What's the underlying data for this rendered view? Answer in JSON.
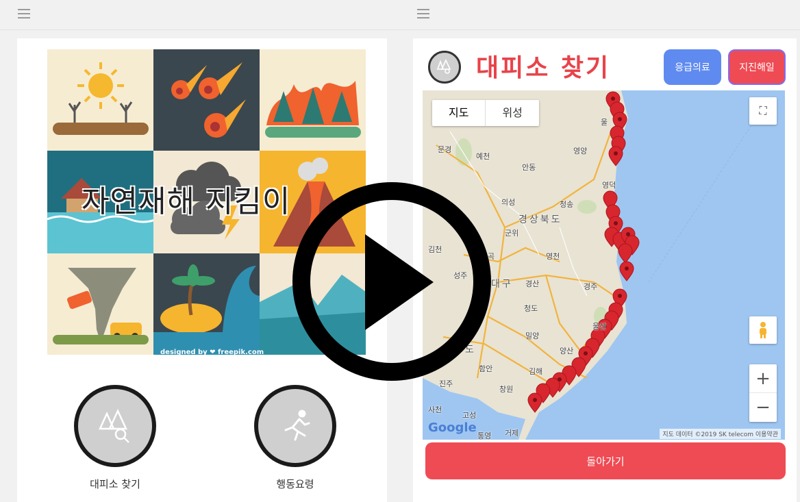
{
  "left_screen": {
    "hero_title": "자연재해 지킴이",
    "hero_credit": "designed by ❤ freepik.com",
    "buttons": [
      {
        "label": "대피소 찾기",
        "icon": "shelter-icon"
      },
      {
        "label": "행동요령",
        "icon": "running-person-icon"
      }
    ]
  },
  "right_screen": {
    "title": "대피소 찾기",
    "emergency_button": "응급의료",
    "earthquake_button": "지진해일",
    "map": {
      "type_buttons": [
        "지도",
        "위성"
      ],
      "labels": {
        "mungyeong": "문경",
        "yecheon": "예천",
        "andong": "안동",
        "yeongyang": "영양",
        "yeongdeok": "영덕",
        "uiseong": "의성",
        "cheongsong": "청송",
        "gyeongbuk": "경상북도",
        "gunwi": "군위",
        "gimcheon": "김천",
        "yeongcheon": "영천",
        "seongju": "성주",
        "daegu": "대구",
        "gyeongsan": "경산",
        "gyeongju": "경주",
        "cheongdo": "청도",
        "ulsan": "울산",
        "miryang": "밀양",
        "yangsan": "양산",
        "haman": "함안",
        "gimhae": "김해",
        "jinju": "진주",
        "changwon": "창원",
        "sacheon": "사천",
        "goseong": "고성",
        "tongyeong": "통영",
        "geoje": "거제",
        "uljin": "울",
        "gok": "곡",
        "do": "도"
      },
      "google_logo": "Google",
      "attribution": "지도 데이터 ©2019 SK telecom   이용약관",
      "zoom_in": "+",
      "zoom_out": "−"
    },
    "back_button": "돌아가기"
  },
  "colors": {
    "accent_red": "#ef4b54",
    "accent_blue": "#5f8bf0",
    "title_red": "#e8434a"
  }
}
